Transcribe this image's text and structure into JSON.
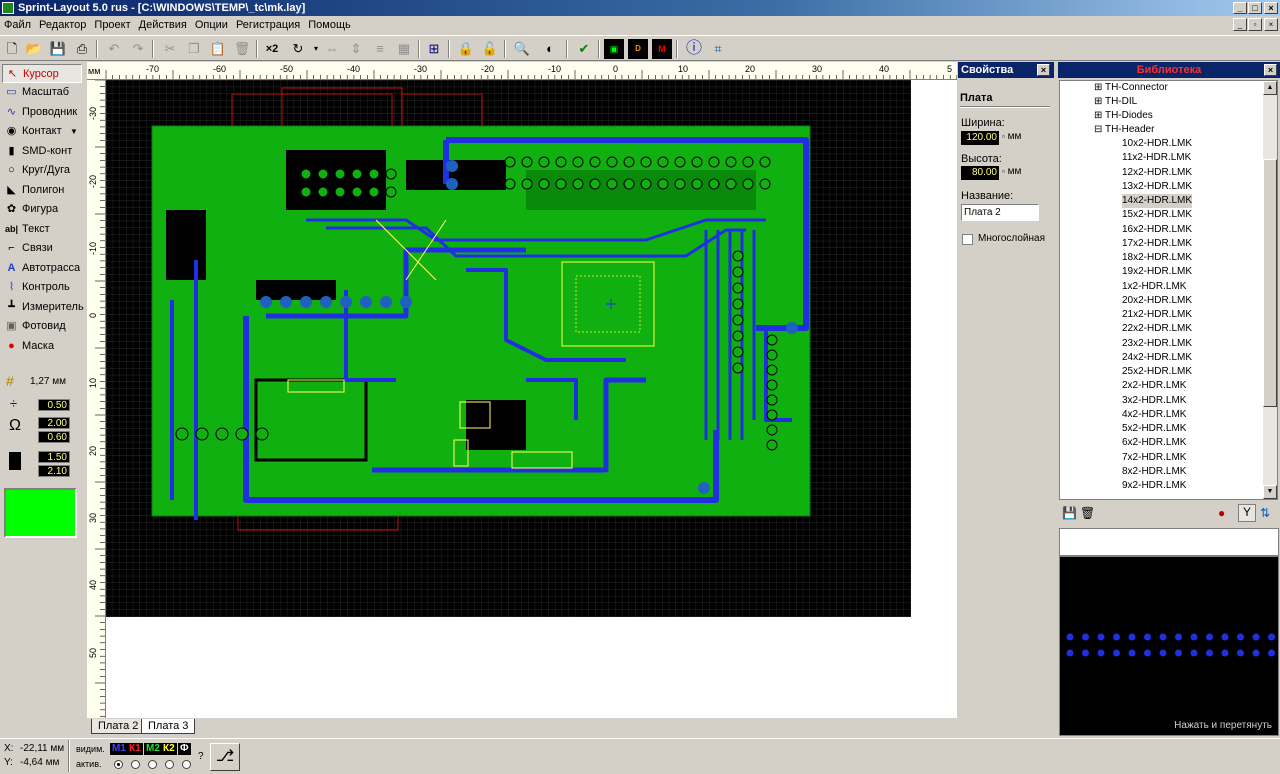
{
  "window": {
    "title": "Sprint-Layout 5.0 rus   - [C:\\WINDOWS\\TEMP\\_tc\\mk.lay]"
  },
  "menu": [
    "Файл",
    "Редактор",
    "Проект",
    "Действия",
    "Опции",
    "Регистрация",
    "Помощь"
  ],
  "toolbar": {
    "zoom_x2": "×2"
  },
  "tools": [
    {
      "label": "Курсор",
      "icon": "cursor-icon",
      "active": true
    },
    {
      "label": "Масштаб",
      "icon": "zoom-icon"
    },
    {
      "label": "Проводник",
      "icon": "track-icon"
    },
    {
      "label": "Контакт",
      "icon": "pad-icon"
    },
    {
      "label": "SMD-конт",
      "icon": "smd-pad-icon"
    },
    {
      "label": "Круг/Дуга",
      "icon": "circle-arc-icon"
    },
    {
      "label": "Полигон",
      "icon": "polygon-icon"
    },
    {
      "label": "Фигура",
      "icon": "shape-icon"
    },
    {
      "label": "Текст",
      "icon": "text-icon"
    },
    {
      "label": "Связи",
      "icon": "connections-icon"
    },
    {
      "label": "Автотрасса",
      "icon": "autoroute-icon"
    },
    {
      "label": "Контроль",
      "icon": "check-icon"
    },
    {
      "label": "Измеритель",
      "icon": "measure-icon"
    },
    {
      "label": "Фотовид",
      "icon": "photo-view-icon"
    },
    {
      "label": "Маска",
      "icon": "mask-icon"
    }
  ],
  "grid": {
    "value": "1,27 мм"
  },
  "track_width": "0.50",
  "pad_outer": "2.00",
  "pad_inner": "0.60",
  "smd_w": "1.50",
  "smd_h": "2.10",
  "active_color": "#00ff00",
  "ruler": {
    "top_ticks": [
      "-70",
      "-60",
      "-50",
      "-40",
      "-30",
      "-20",
      "-10",
      "0",
      "10",
      "20",
      "30",
      "40",
      "5"
    ],
    "left_ticks": [
      "-30",
      "-20",
      "-10",
      "0",
      "10",
      "20",
      "30",
      "40",
      "50"
    ],
    "unit": "мм"
  },
  "tabs": [
    "Плата  2",
    "Плата  3"
  ],
  "properties": {
    "header": "Свойства",
    "section": "Плата",
    "width_label": "Ширина:",
    "width_value": "120.00",
    "height_label": "Высота:",
    "height_value": "80.00",
    "unit": "мм",
    "name_label": "Название:",
    "name_value": "Плата  2",
    "multilayer_label": "Многослойная"
  },
  "library": {
    "header": "Библиотека",
    "folders": [
      "TH-Connector",
      "TH-DIL",
      "TH-Diodes",
      "TH-Header"
    ],
    "items": [
      "10x2-HDR.LMK",
      "11x2-HDR.LMK",
      "12x2-HDR.LMK",
      "13x2-HDR.LMK",
      "14x2-HDR.LMK",
      "15x2-HDR.LMK",
      "16x2-HDR.LMK",
      "17x2-HDR.LMK",
      "18x2-HDR.LMK",
      "19x2-HDR.LMK",
      "1x2-HDR.LMK",
      "20x2-HDR.LMK",
      "21x2-HDR.LMK",
      "22x2-HDR.LMK",
      "23x2-HDR.LMK",
      "24x2-HDR.LMK",
      "25x2-HDR.LMK",
      "2x2-HDR.LMK",
      "3x2-HDR.LMK",
      "4x2-HDR.LMK",
      "5x2-HDR.LMK",
      "6x2-HDR.LMK",
      "7x2-HDR.LMK",
      "8x2-HDR.LMK",
      "9x2-HDR.LMK"
    ],
    "selected": "14x2-HDR.LMK",
    "preview_hint": "Нажать и перетянуть"
  },
  "status": {
    "x_label": "X:",
    "x_value": "-22,11 мм",
    "y_label": "Y:",
    "y_value": "-4,64 мм",
    "visible_label": "видим.",
    "active_label": "актив.",
    "layers": [
      {
        "name": "М1",
        "color": "#4040ff"
      },
      {
        "name": "К1",
        "color": "#ff2020"
      },
      {
        "name": "М2",
        "color": "#20e020"
      },
      {
        "name": "К2",
        "color": "#ffff40"
      },
      {
        "name": "Ф",
        "color": "#ffffff"
      }
    ],
    "help": "?"
  }
}
